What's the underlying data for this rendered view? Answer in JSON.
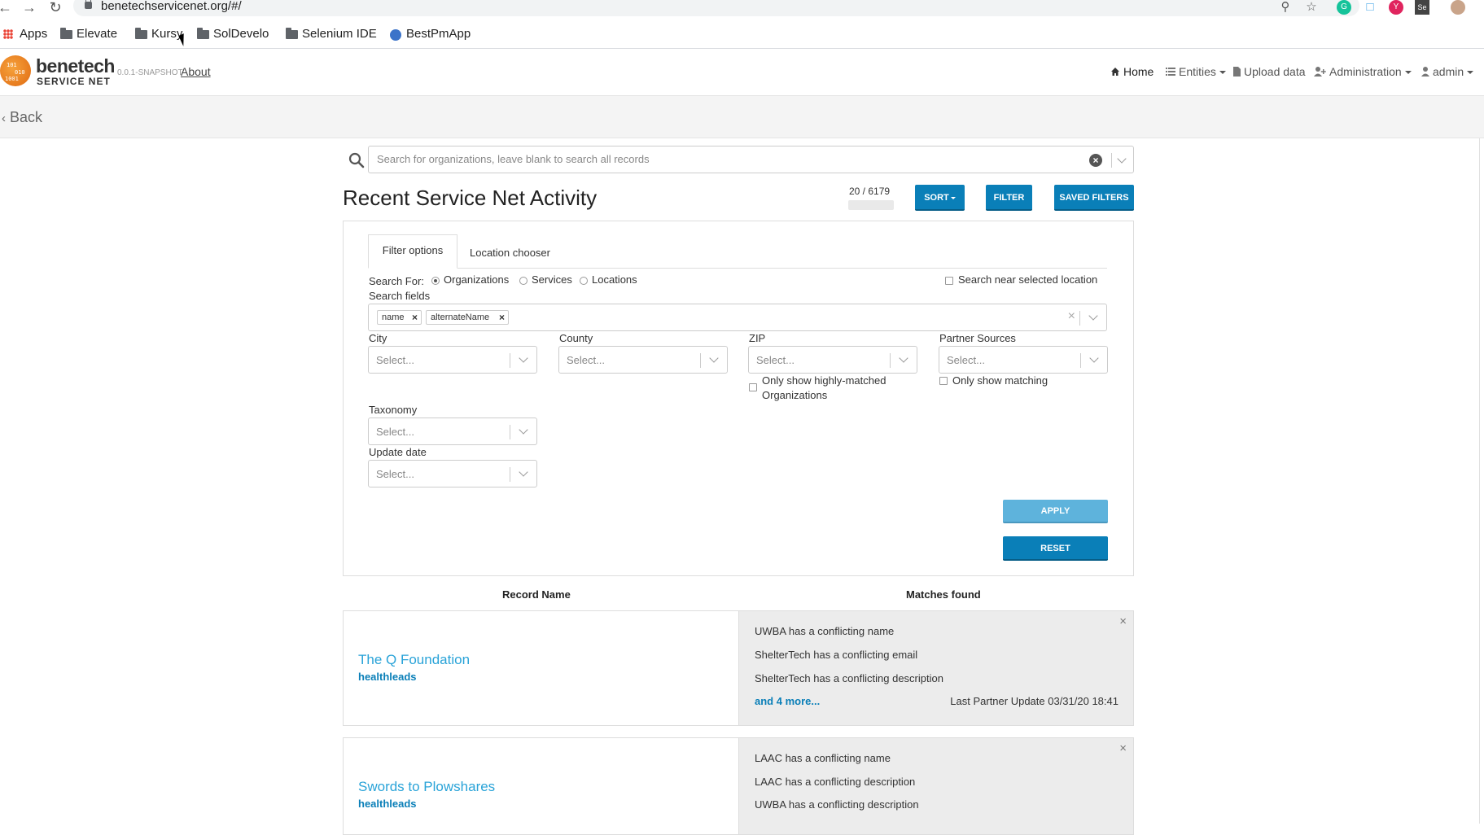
{
  "browser": {
    "url": "benetechservicenet.org/#/",
    "bookmarks": [
      {
        "label": "Apps",
        "icon": "apps-grid-icon"
      },
      {
        "label": "Elevate",
        "icon": "folder-icon"
      },
      {
        "label": "Kursy",
        "icon": "folder-icon"
      },
      {
        "label": "SolDevelo",
        "icon": "folder-icon"
      },
      {
        "label": "Selenium IDE",
        "icon": "folder-icon"
      },
      {
        "label": "BestPmApp",
        "icon": "bestpmapp-icon"
      }
    ]
  },
  "header": {
    "logo_line1": "benetech",
    "logo_line2": "SERVICE NET",
    "version": "0.0.1-SNAPSHOT",
    "about": "About",
    "nav": {
      "home": "Home",
      "entities": "Entities",
      "upload": "Upload data",
      "administration": "Administration",
      "account": "admin"
    }
  },
  "back_label": "Back",
  "search": {
    "placeholder": "Search for organizations, leave blank to search all records"
  },
  "title": "Recent Service Net Activity",
  "count": "20 / 6179",
  "buttons": {
    "sort": "SORT",
    "filter": "FILTER",
    "saved_filters": "SAVED FILTERS",
    "apply": "APPLY",
    "reset": "RESET"
  },
  "filter": {
    "tabs": [
      "Filter options",
      "Location chooser"
    ],
    "search_for_label": "Search For:",
    "search_for_options": [
      "Organizations",
      "Services",
      "Locations"
    ],
    "search_for_selected": "Organizations",
    "near_location": "Search near selected location",
    "search_fields_label": "Search fields",
    "search_fields_chips": [
      "name",
      "alternateName"
    ],
    "city": {
      "label": "City",
      "placeholder": "Select..."
    },
    "county": {
      "label": "County",
      "placeholder": "Select..."
    },
    "zip": {
      "label": "ZIP",
      "placeholder": "Select..."
    },
    "partner_sources": {
      "label": "Partner Sources",
      "placeholder": "Select..."
    },
    "only_highly_matched_1": "Only show highly-matched",
    "only_highly_matched_2": "Organizations",
    "only_matching": "Only show matching",
    "taxonomy": {
      "label": "Taxonomy",
      "placeholder": "Select..."
    },
    "update_date": {
      "label": "Update date",
      "placeholder": "Select..."
    }
  },
  "columns": {
    "record_name": "Record Name",
    "matches_found": "Matches found"
  },
  "records": [
    {
      "name": "The Q Foundation",
      "source": "healthleads",
      "matches": [
        "UWBA has a conflicting name",
        "ShelterTech has a conflicting email",
        "ShelterTech has a conflicting description"
      ],
      "more": "and 4 more...",
      "last_update": "Last Partner Update 03/31/20 18:41"
    },
    {
      "name": "Swords to Plowshares",
      "source": "healthleads",
      "matches": [
        "LAAC has a conflicting name",
        "LAAC has a conflicting description",
        "UWBA has a conflicting description"
      ]
    }
  ],
  "colors": {
    "primary_button": "#0a7fb8",
    "apply_button": "#5eb3dc",
    "record_link": "#29a3d8",
    "logo_orange": "#e06a12"
  }
}
